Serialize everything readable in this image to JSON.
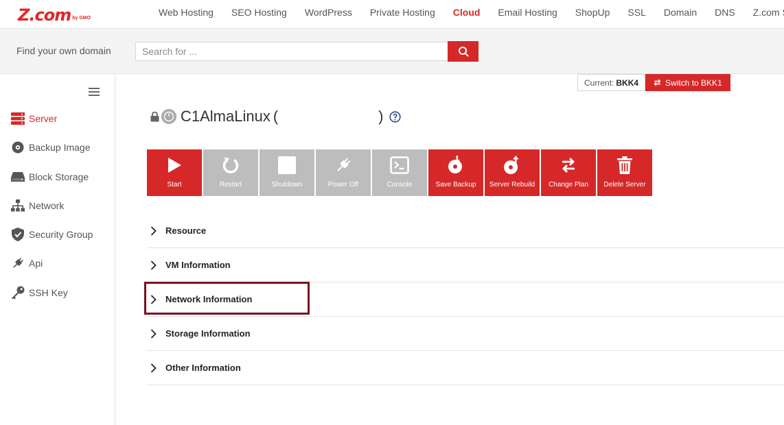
{
  "brand": {
    "logo_main": "Z.com",
    "logo_sub": "by GMO",
    "accent": "#d62828"
  },
  "topnav": {
    "items": [
      {
        "label": "Web Hosting"
      },
      {
        "label": "SEO Hosting"
      },
      {
        "label": "WordPress"
      },
      {
        "label": "Private Hosting"
      },
      {
        "label": "Cloud",
        "active": true
      },
      {
        "label": "Email Hosting"
      },
      {
        "label": "ShopUp"
      },
      {
        "label": "SSL"
      },
      {
        "label": "Domain"
      },
      {
        "label": "DNS"
      },
      {
        "label": "Z.com Sign"
      }
    ]
  },
  "search": {
    "label": "Find your own domain",
    "placeholder": "Search for ...",
    "value": "",
    "button_icon": "search-icon"
  },
  "sidebar": {
    "items": [
      {
        "label": "Server",
        "icon": "server-icon",
        "active": true
      },
      {
        "label": "Backup Image",
        "icon": "disc-icon"
      },
      {
        "label": "Block Storage",
        "icon": "hard-drive-icon"
      },
      {
        "label": "Network",
        "icon": "network-icon"
      },
      {
        "label": "Security Group",
        "icon": "shield-icon"
      },
      {
        "label": "Api",
        "icon": "plug-icon"
      },
      {
        "label": "SSH Key",
        "icon": "key-icon"
      }
    ]
  },
  "region": {
    "current_label": "Current:",
    "current_value": "BKK4",
    "switch_label": "Switch to BKK1"
  },
  "server": {
    "name": "C1AlmaLinux",
    "open_paren": "(",
    "close_paren": ")"
  },
  "actions": [
    {
      "label": "Start",
      "icon": "play-icon",
      "enabled": true
    },
    {
      "label": "Restart",
      "icon": "restart-icon",
      "enabled": false
    },
    {
      "label": "Shutdown",
      "icon": "stop-icon",
      "enabled": false
    },
    {
      "label": "Power Off",
      "icon": "power-plug-icon",
      "enabled": false
    },
    {
      "label": "Console",
      "icon": "console-icon",
      "enabled": false
    },
    {
      "label": "Save Backup",
      "icon": "save-backup-icon",
      "enabled": true
    },
    {
      "label": "Server Rebuild",
      "icon": "rebuild-icon",
      "enabled": true
    },
    {
      "label": "Change Plan",
      "icon": "swap-icon",
      "enabled": true
    },
    {
      "label": "Delete Server",
      "icon": "trash-icon",
      "enabled": true
    }
  ],
  "sections": [
    {
      "label": "Resource"
    },
    {
      "label": "VM Information"
    },
    {
      "label": "Network Information",
      "highlighted": true
    },
    {
      "label": "Storage Information"
    },
    {
      "label": "Other Information"
    }
  ],
  "colors": {
    "highlight_border": "#7a0f1f",
    "disabled_button": "#bdbdbd"
  }
}
